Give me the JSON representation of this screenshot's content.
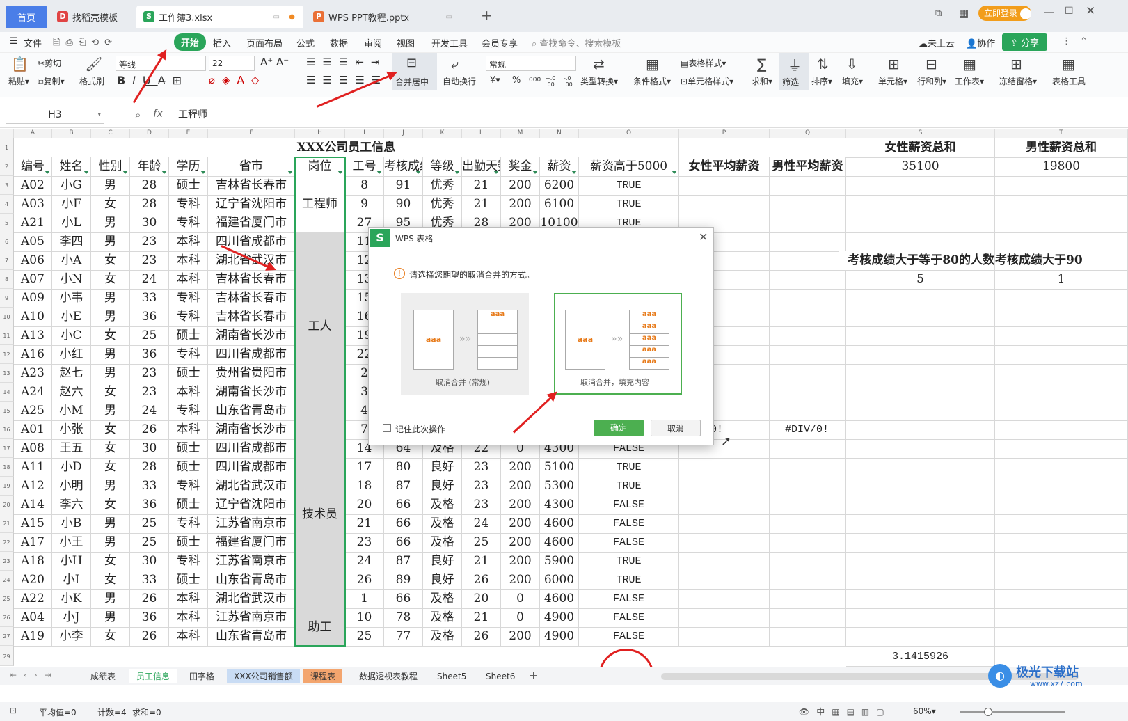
{
  "tabs": [
    {
      "label": "首页"
    },
    {
      "label": "找稻壳模板"
    },
    {
      "label": "工作簿3.xlsx"
    },
    {
      "label": "WPS PPT教程.pptx"
    }
  ],
  "login_label": "立即登录",
  "menu": [
    "文件",
    "开始",
    "插入",
    "页面布局",
    "公式",
    "数据",
    "审阅",
    "视图",
    "开发工具",
    "会员专享"
  ],
  "search_placeholder": "查找命令、搜索模板",
  "cloud": "未上云",
  "collab": "协作",
  "share": "分享",
  "ribbon": {
    "paste": "粘贴",
    "cut": "剪切",
    "copy": "复制",
    "format_painter": "格式刷",
    "font": "等线",
    "font_size": "22",
    "merge": "合并居中",
    "wrap": "自动换行",
    "number_format": "常规",
    "type_convert": "类型转换",
    "cond_format": "条件格式",
    "table_style": "表格样式",
    "cell_style": "单元格样式",
    "sum": "求和",
    "filter": "筛选",
    "sort": "排序",
    "fill": "填充",
    "cell": "单元格",
    "rowcol": "行和列",
    "sheet": "工作表",
    "freeze": "冻结窗格",
    "table_tools": "表格工具",
    "currency": "¥",
    "percent": "%",
    "thousand": "000",
    "inc_dec": "+.0 .00",
    "dec_dec": "-.0 .00"
  },
  "name_box": "H3",
  "formula": "工程师",
  "columns": [
    "A",
    "B",
    "C",
    "D",
    "E",
    "F",
    "H",
    "I",
    "J",
    "K",
    "L",
    "M",
    "N",
    "O",
    "P",
    "Q",
    "S",
    "T"
  ],
  "title": "XXX公司员工信息",
  "headers": [
    "编号",
    "姓名",
    "性别",
    "年龄",
    "学历",
    "省市",
    "岗位",
    "工号",
    "考核成绩",
    "等级",
    "出勤天数",
    "奖金",
    "薪资",
    "薪资高于5000"
  ],
  "side_headers": {
    "female_avg": "女性平均薪资",
    "male_avg": "男性平均薪资",
    "female_sum": "女性薪资总和",
    "male_sum": "男性薪资总和",
    "female_sum_val": "35100",
    "male_sum_val": "19800",
    "cnt80": "考核成绩大于等于80的人数",
    "cnt90": "考核成绩大于90",
    "cnt80_val": "5",
    "cnt90_val": "1",
    "div1": "#DIV/0!",
    "div2": "#DIV/0!",
    "pi": "3.1415926"
  },
  "positions": [
    {
      "label": "工程师"
    },
    {
      "label": "工人"
    },
    {
      "label": "技术员"
    },
    {
      "label": "助工"
    }
  ],
  "rows": [
    [
      "A02",
      "小G",
      "男",
      "28",
      "硕士",
      "吉林省长春市",
      "8",
      "91",
      "优秀",
      "21",
      "200",
      "6200",
      "TRUE"
    ],
    [
      "A03",
      "小F",
      "女",
      "28",
      "专科",
      "辽宁省沈阳市",
      "9",
      "90",
      "优秀",
      "21",
      "200",
      "6100",
      "TRUE"
    ],
    [
      "A21",
      "小L",
      "男",
      "30",
      "专科",
      "福建省厦门市",
      "27",
      "95",
      "优秀",
      "28",
      "200",
      "10100",
      "TRUE"
    ],
    [
      "A05",
      "李四",
      "男",
      "23",
      "本科",
      "四川省成都市",
      "11",
      "",
      "",
      "",
      "",
      "",
      ""
    ],
    [
      "A06",
      "小A",
      "女",
      "23",
      "本科",
      "湖北省武汉市",
      "12",
      "",
      "",
      "",
      "",
      "",
      ""
    ],
    [
      "A07",
      "小N",
      "女",
      "24",
      "本科",
      "吉林省长春市",
      "13",
      "",
      "",
      "",
      "",
      "",
      ""
    ],
    [
      "A09",
      "小韦",
      "男",
      "33",
      "专科",
      "吉林省长春市",
      "15",
      "",
      "",
      "",
      "",
      "",
      ""
    ],
    [
      "A10",
      "小E",
      "男",
      "36",
      "专科",
      "吉林省长春市",
      "16",
      "",
      "",
      "",
      "",
      "",
      ""
    ],
    [
      "A13",
      "小C",
      "女",
      "25",
      "硕士",
      "湖南省长沙市",
      "19",
      "",
      "",
      "",
      "",
      "",
      ""
    ],
    [
      "A16",
      "小红",
      "男",
      "36",
      "专科",
      "四川省成都市",
      "22",
      "",
      "",
      "",
      "",
      "",
      ""
    ],
    [
      "A23",
      "赵七",
      "男",
      "23",
      "硕士",
      "贵州省贵阳市",
      "2",
      "",
      "",
      "",
      "",
      "",
      ""
    ],
    [
      "A24",
      "赵六",
      "女",
      "23",
      "本科",
      "湖南省长沙市",
      "3",
      "",
      "",
      "",
      "",
      "",
      ""
    ],
    [
      "A25",
      "小M",
      "男",
      "24",
      "专科",
      "山东省青岛市",
      "4",
      "",
      "",
      "",
      "",
      "",
      ""
    ],
    [
      "A01",
      "小张",
      "女",
      "26",
      "本科",
      "湖南省长沙市",
      "7",
      "",
      "",
      "",
      "",
      "",
      ""
    ],
    [
      "A08",
      "王五",
      "女",
      "30",
      "硕士",
      "四川省成都市",
      "14",
      "64",
      "及格",
      "22",
      "0",
      "4300",
      "FALSE"
    ],
    [
      "A11",
      "小D",
      "女",
      "28",
      "硕士",
      "四川省成都市",
      "17",
      "80",
      "良好",
      "23",
      "200",
      "5100",
      "TRUE"
    ],
    [
      "A12",
      "小明",
      "男",
      "33",
      "专科",
      "湖北省武汉市",
      "18",
      "87",
      "良好",
      "23",
      "200",
      "5300",
      "TRUE"
    ],
    [
      "A14",
      "李六",
      "女",
      "36",
      "硕士",
      "辽宁省沈阳市",
      "20",
      "66",
      "及格",
      "23",
      "200",
      "4300",
      "FALSE"
    ],
    [
      "A15",
      "小B",
      "男",
      "25",
      "专科",
      "江苏省南京市",
      "21",
      "66",
      "及格",
      "24",
      "200",
      "4600",
      "FALSE"
    ],
    [
      "A17",
      "小王",
      "男",
      "25",
      "硕士",
      "福建省厦门市",
      "23",
      "66",
      "及格",
      "25",
      "200",
      "4600",
      "FALSE"
    ],
    [
      "A18",
      "小H",
      "女",
      "30",
      "专科",
      "江苏省南京市",
      "24",
      "87",
      "良好",
      "21",
      "200",
      "5900",
      "TRUE"
    ],
    [
      "A20",
      "小I",
      "女",
      "33",
      "硕士",
      "山东省青岛市",
      "26",
      "89",
      "良好",
      "26",
      "200",
      "6000",
      "TRUE"
    ],
    [
      "A22",
      "小K",
      "男",
      "26",
      "本科",
      "湖北省武汉市",
      "1",
      "66",
      "及格",
      "20",
      "0",
      "4600",
      "FALSE"
    ],
    [
      "A04",
      "小J",
      "男",
      "36",
      "本科",
      "江苏省南京市",
      "10",
      "78",
      "及格",
      "21",
      "0",
      "4900",
      "FALSE"
    ],
    [
      "A19",
      "小李",
      "女",
      "26",
      "本科",
      "山东省青岛市",
      "25",
      "77",
      "及格",
      "26",
      "200",
      "4900",
      "FALSE"
    ]
  ],
  "sheets": [
    "成绩表",
    "员工信息",
    "田字格",
    "XXX公司销售额",
    "课程表",
    "数据透视表教程",
    "Sheet5",
    "Sheet6"
  ],
  "status": {
    "avg": "平均值=0",
    "count": "计数=4",
    "sum": "求和=0",
    "zoom": "60%"
  },
  "dialog": {
    "title": "WPS 表格",
    "prompt": "请选择您期望的取消合并的方式。",
    "opt1": "取消合并 (常规)",
    "opt2": "取消合并，填充内容",
    "sample": "aaa",
    "remember": "记住此次操作",
    "ok": "确定",
    "cancel": "取消"
  },
  "watermark": "极光下载站",
  "watermark_url": "www.xz7.com"
}
